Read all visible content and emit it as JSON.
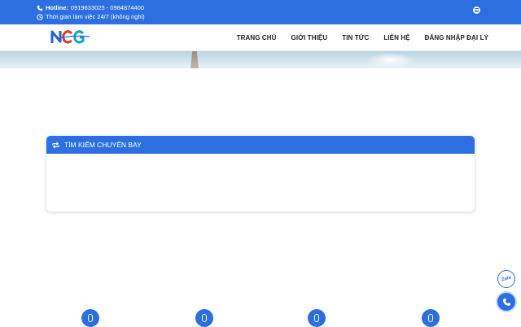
{
  "topbar": {
    "hotline_label": "Hotline:",
    "hotline_numbers": "0919633025 - 0984874400",
    "hours": "Thời gian làm việc 24/7 (không nghỉ)"
  },
  "nav": {
    "items": [
      {
        "label": "TRANG CHỦ"
      },
      {
        "label": "GIỚI THIỆU"
      },
      {
        "label": "TIN TỨC"
      },
      {
        "label": "LIÊN HỆ"
      },
      {
        "label": "ĐĂNG NHẬP ĐẠI LÝ"
      }
    ]
  },
  "search": {
    "title": "TÌM KIẾM CHUYẾN BAY"
  },
  "floating": {
    "zalo_label": "Zalo"
  },
  "colors": {
    "brand_blue": "#2c6fe0"
  }
}
